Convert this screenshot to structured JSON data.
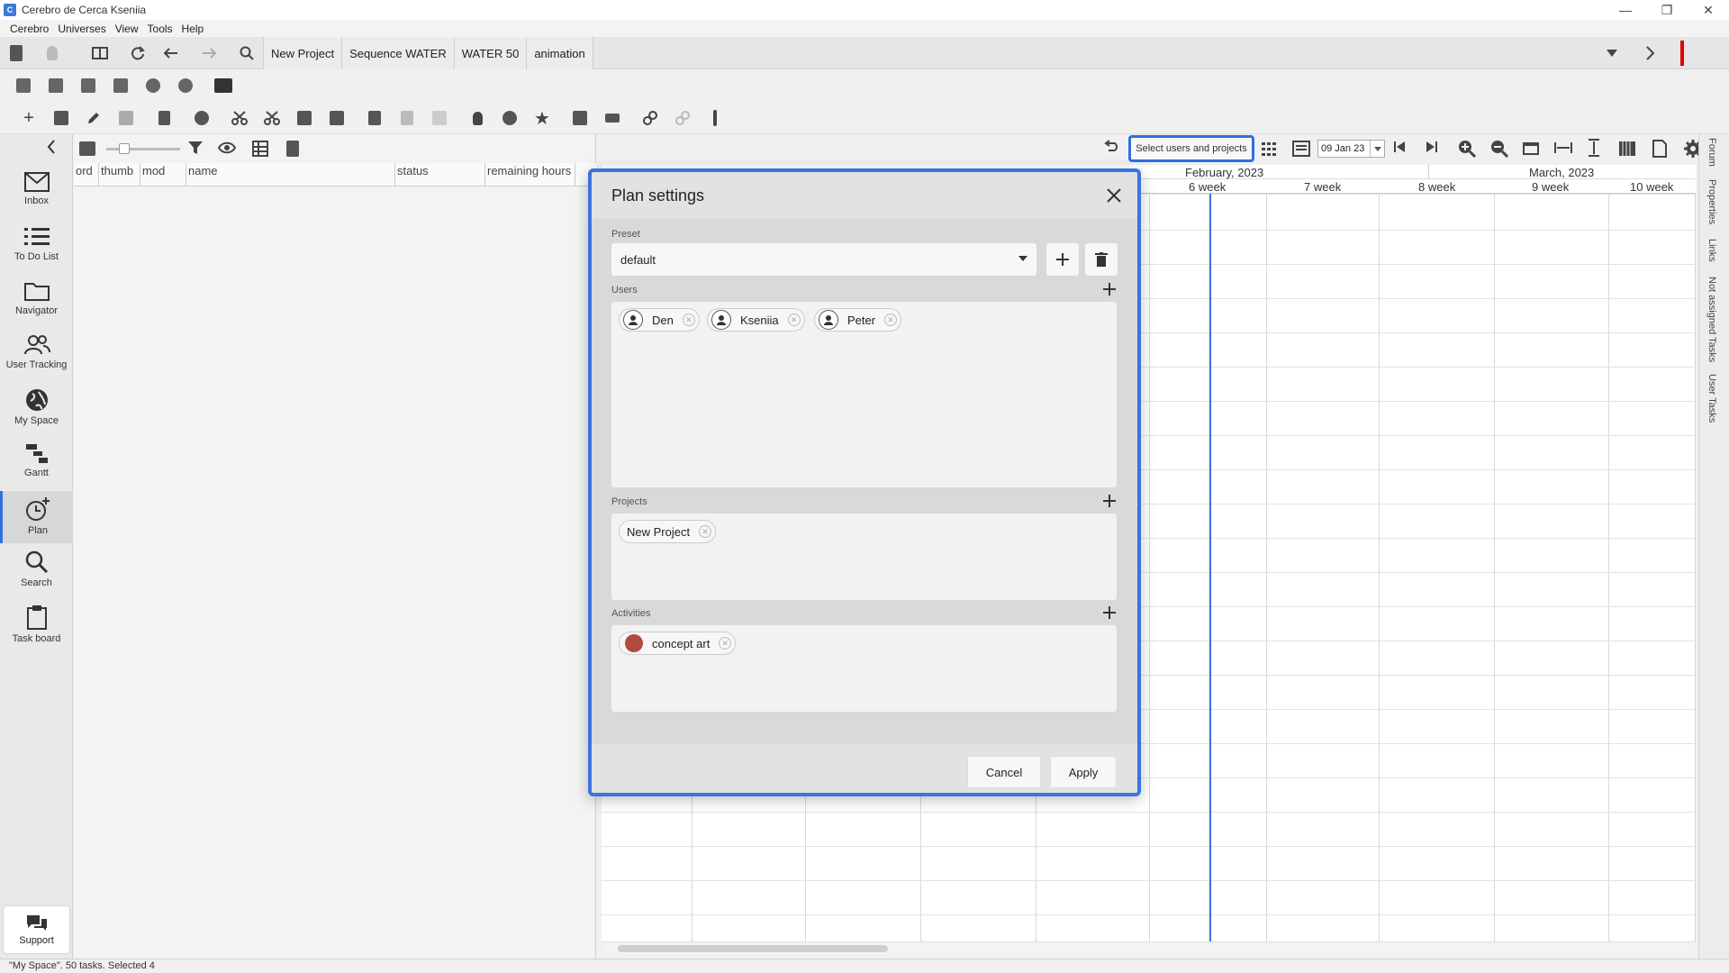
{
  "window": {
    "title": "Cerebro de Cerca   Kseniia",
    "app_icon": "cerebro-app-icon"
  },
  "menu": [
    "Cerebro",
    "Universes",
    "View",
    "Tools",
    "Help"
  ],
  "breadcrumbs": [
    "New Project",
    "Sequence WATER",
    "WATER 50",
    "animation"
  ],
  "sidebar": {
    "items": [
      {
        "label": "Inbox",
        "icon": "inbox-icon"
      },
      {
        "label": "To Do List",
        "icon": "list-icon"
      },
      {
        "label": "Navigator",
        "icon": "folder-icon"
      },
      {
        "label": "User Tracking",
        "icon": "users-icon"
      },
      {
        "label": "My Space",
        "icon": "globe-icon"
      },
      {
        "label": "Gantt",
        "icon": "gantt-icon"
      },
      {
        "label": "Plan",
        "icon": "plan-icon"
      },
      {
        "label": "Search",
        "icon": "search-icon"
      },
      {
        "label": "Task board",
        "icon": "clipboard-icon"
      }
    ],
    "active": "Plan",
    "support_label": "Support"
  },
  "tasklist": {
    "columns": [
      "ord",
      "thumb",
      "mod",
      "name",
      "status",
      "remaining hours"
    ]
  },
  "gantt": {
    "select_button": "Select users and projects",
    "date_value": "09 Jan 23",
    "months": [
      "February, 2023",
      "March, 2023"
    ],
    "weeks": [
      "6 week",
      "7 week",
      "8 week",
      "9 week",
      "10 week"
    ]
  },
  "right_tabs": [
    "Forum",
    "Properties",
    "Links",
    "Not assigned Tasks",
    "User Tasks"
  ],
  "modal": {
    "title": "Plan settings",
    "preset_label": "Preset",
    "preset_value": "default",
    "users_label": "Users",
    "users": [
      "Den",
      "Kseniia",
      "Peter"
    ],
    "projects_label": "Projects",
    "projects": [
      "New Project"
    ],
    "activities_label": "Activities",
    "activities": [
      {
        "name": "concept art",
        "color": "#b24a3f"
      }
    ],
    "cancel_label": "Cancel",
    "apply_label": "Apply"
  },
  "status_bar": "\"My Space\". 50 tasks. Selected 4",
  "colors": {
    "accent": "#2f6fe0",
    "modal_border": "#3c73e0",
    "today_line": "#3c73e0"
  }
}
